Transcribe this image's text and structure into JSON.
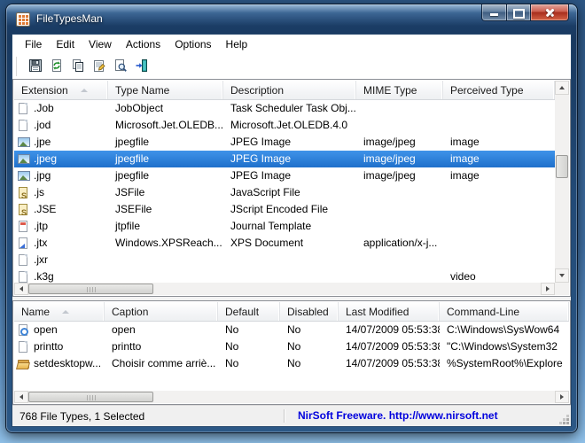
{
  "window": {
    "title": "FileTypesMan"
  },
  "titlebar": {
    "buttons": [
      {
        "name": "minimize",
        "icon": "minimize-icon"
      },
      {
        "name": "maximize",
        "icon": "maximize-icon"
      },
      {
        "name": "close",
        "icon": "close-icon"
      }
    ]
  },
  "menu": {
    "items": [
      "File",
      "Edit",
      "View",
      "Actions",
      "Options",
      "Help"
    ]
  },
  "toolbar": {
    "buttons": [
      {
        "name": "save",
        "icon": "save-icon"
      },
      {
        "name": "refresh",
        "icon": "refresh-icon"
      },
      {
        "name": "copy",
        "icon": "copy-icon"
      },
      {
        "name": "properties",
        "icon": "properties-icon"
      },
      {
        "name": "find",
        "icon": "find-icon"
      },
      {
        "name": "exit",
        "icon": "exit-icon"
      }
    ]
  },
  "top_list": {
    "columns": [
      {
        "label": "Extension",
        "sorted": true
      },
      {
        "label": "Type Name",
        "sorted": false
      },
      {
        "label": "Description",
        "sorted": false
      },
      {
        "label": "MIME Type",
        "sorted": false
      },
      {
        "label": "Perceived Type",
        "sorted": false
      }
    ],
    "rows": [
      {
        "icon": "blank-doc",
        "selected": false,
        "cells": [
          ".Job",
          "JobObject",
          "Task Scheduler Task Obj...",
          "",
          ""
        ]
      },
      {
        "icon": "blank-doc",
        "selected": false,
        "cells": [
          ".jod",
          "Microsoft.Jet.OLEDB...",
          "Microsoft.Jet.OLEDB.4.0",
          "",
          ""
        ]
      },
      {
        "icon": "image",
        "selected": false,
        "cells": [
          ".jpe",
          "jpegfile",
          "JPEG Image",
          "image/jpeg",
          "image"
        ]
      },
      {
        "icon": "image",
        "selected": true,
        "cells": [
          ".jpeg",
          "jpegfile",
          "JPEG Image",
          "image/jpeg",
          "image"
        ]
      },
      {
        "icon": "image",
        "selected": false,
        "cells": [
          ".jpg",
          "jpegfile",
          "JPEG Image",
          "image/jpeg",
          "image"
        ]
      },
      {
        "icon": "script",
        "selected": false,
        "cells": [
          ".js",
          "JSFile",
          "JavaScript File",
          "",
          ""
        ]
      },
      {
        "icon": "script",
        "selected": false,
        "cells": [
          ".JSE",
          "JSEFile",
          "JScript Encoded File",
          "",
          ""
        ]
      },
      {
        "icon": "journal",
        "selected": false,
        "cells": [
          ".jtp",
          "jtpfile",
          "Journal Template",
          "",
          ""
        ]
      },
      {
        "icon": "xps",
        "selected": false,
        "cells": [
          ".jtx",
          "Windows.XPSReach...",
          "XPS Document",
          "application/x-j...",
          ""
        ]
      },
      {
        "icon": "blank-doc",
        "selected": false,
        "cells": [
          ".jxr",
          "",
          "",
          "",
          ""
        ]
      },
      {
        "icon": "blank-doc",
        "selected": false,
        "cells": [
          ".k3g",
          "",
          "",
          "",
          "video"
        ]
      }
    ]
  },
  "bottom_list": {
    "columns": [
      {
        "label": "Name",
        "sorted": true
      },
      {
        "label": "Caption",
        "sorted": false
      },
      {
        "label": "Default",
        "sorted": false
      },
      {
        "label": "Disabled",
        "sorted": false
      },
      {
        "label": "Last Modified",
        "sorted": false
      },
      {
        "label": "Command-Line",
        "sorted": false
      }
    ],
    "rows": [
      {
        "icon": "open-action",
        "selected": false,
        "cells": [
          "open",
          "open",
          "No",
          "No",
          "14/07/2009 05:53:38",
          "C:\\Windows\\SysWow64"
        ]
      },
      {
        "icon": "blank-doc",
        "selected": false,
        "cells": [
          "printto",
          "printto",
          "No",
          "No",
          "14/07/2009 05:53:38",
          "\"C:\\Windows\\System32"
        ]
      },
      {
        "icon": "folder-open",
        "selected": false,
        "cells": [
          "setdesktopw...",
          "Choisir comme arriè...",
          "No",
          "No",
          "14/07/2009 05:53:38",
          "%SystemRoot%\\Explore"
        ]
      }
    ]
  },
  "statusbar": {
    "left": "768 File Types, 1 Selected",
    "right": "NirSoft Freeware.  http://www.nirsoft.net"
  },
  "colors": {
    "selection_top": "#3f93e9",
    "selection_bottom": "#1f70cb",
    "link_blue": "#0000dd",
    "close_button_red": "#c23b27",
    "frame_blue": "#19395f"
  }
}
